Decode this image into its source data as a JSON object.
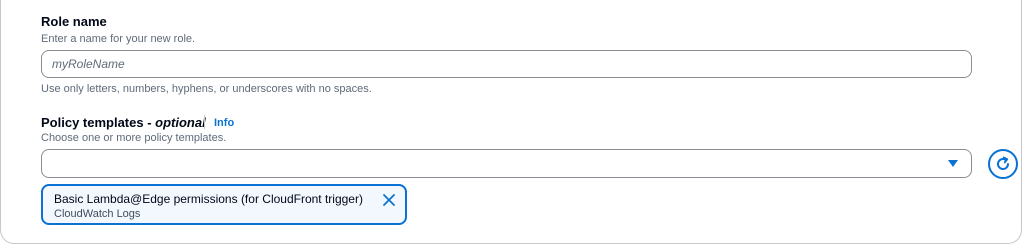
{
  "role_name": {
    "label": "Role name",
    "description": "Enter a name for your new role.",
    "placeholder": "myRoleName",
    "constraint": "Use only letters, numbers, hyphens, or underscores with no spaces."
  },
  "policy_templates": {
    "label": "Policy templates - ",
    "optional_label": "optional",
    "info_link": "Info",
    "description": "Choose one or more policy templates.",
    "select_value": "",
    "selected_tokens": [
      {
        "title": "Basic Lambda@Edge permissions (for CloudFront trigger)",
        "subtitle": "CloudWatch Logs"
      }
    ]
  },
  "icons": {
    "refresh": "refresh-icon",
    "dropdown": "caret-down-icon",
    "dismiss": "close-icon"
  },
  "colors": {
    "accent": "#0972d3",
    "token_background": "#f2f8fd",
    "text": "#000716",
    "secondary_text": "#5f6b7a",
    "border": "#8c8c94"
  }
}
